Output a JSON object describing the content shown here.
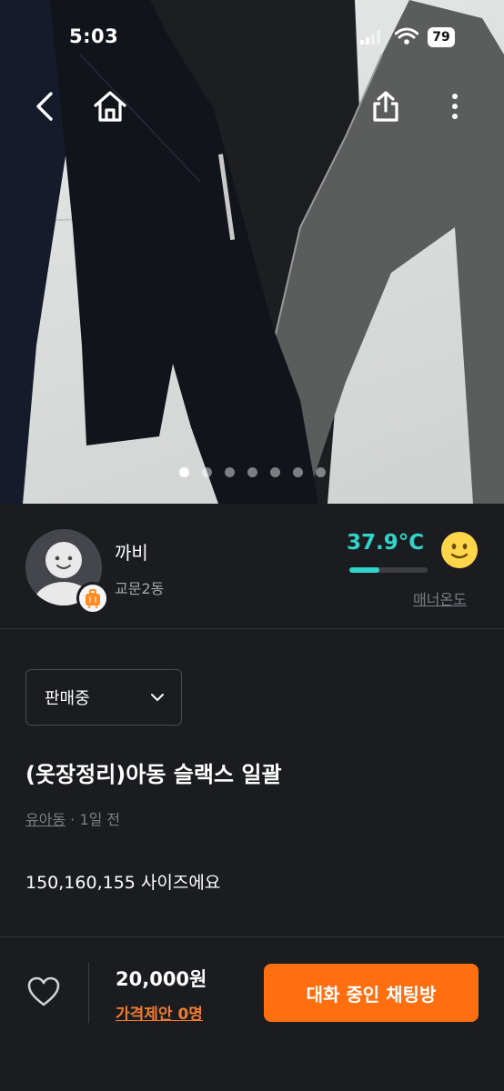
{
  "status_bar": {
    "time": "5:03",
    "battery": "79"
  },
  "nav": {
    "back_icon": "chevron-left-icon",
    "home_icon": "home-icon",
    "share_icon": "share-icon",
    "more_icon": "more-vertical-icon"
  },
  "gallery": {
    "image_count": 7,
    "active_index": 0
  },
  "seller": {
    "name": "까비",
    "location": "교문2동",
    "temperature": "37.9°C",
    "temperature_value": 37.9,
    "manner_label": "매너온도",
    "badge_icon": "suitcase-icon"
  },
  "product": {
    "status": "판매중",
    "title": "(옷장정리)아동 슬랙스 일괄",
    "category": "유아동",
    "time": "· 1일 전",
    "description": "150,160,155 사이즈에요"
  },
  "footer": {
    "price": "20,000원",
    "offer": "가격제안 0명",
    "chat_button": "대화 중인 채팅방"
  },
  "colors": {
    "accent": "#ff6f0f",
    "temperature": "#31d4c9",
    "background": "#1b1c20"
  }
}
